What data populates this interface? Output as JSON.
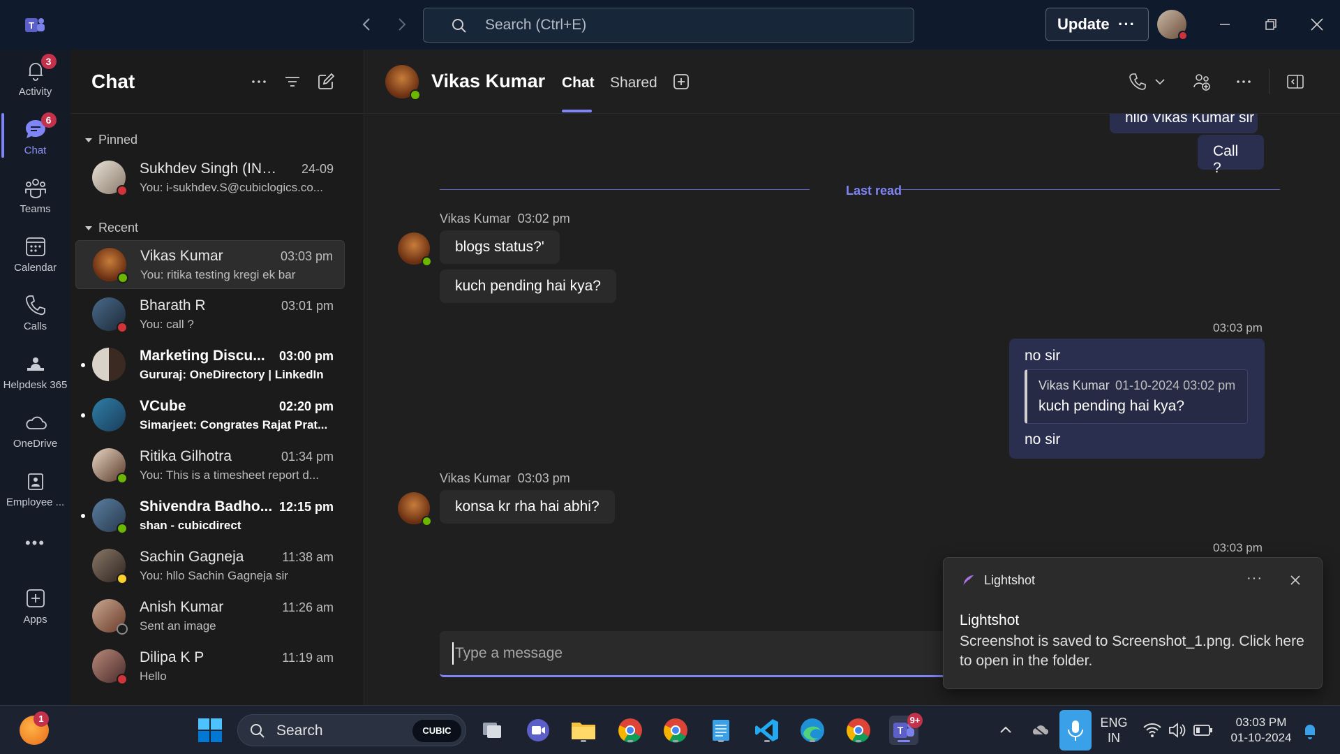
{
  "titlebar": {
    "search_placeholder": "Search (Ctrl+E)",
    "update_label": "Update",
    "update_more": "···"
  },
  "rail": {
    "items": [
      {
        "label": "Activity",
        "badge": "3",
        "icon": "bell-icon"
      },
      {
        "label": "Chat",
        "badge": "6",
        "icon": "chat-icon",
        "active": true
      },
      {
        "label": "Teams",
        "icon": "teams-icon"
      },
      {
        "label": "Calendar",
        "icon": "calendar-icon"
      },
      {
        "label": "Calls",
        "icon": "phone-icon"
      },
      {
        "label": "Helpdesk 365",
        "icon": "helpdesk-icon"
      },
      {
        "label": "OneDrive",
        "icon": "cloud-icon"
      },
      {
        "label": "Employee ...",
        "icon": "employee-icon"
      },
      {
        "label": "Apps",
        "icon": "apps-icon"
      }
    ],
    "more": "•••"
  },
  "chatlist": {
    "title": "Chat",
    "pinned_label": "Pinned",
    "recent_label": "Recent",
    "pinned": [
      {
        "name": "Sukhdev Singh (INT) ...",
        "time": "24-09",
        "preview": "You: i-sukhdev.S@cubiclogics.co...",
        "status": "busy"
      }
    ],
    "recent": [
      {
        "name": "Vikas Kumar",
        "time": "03:03 pm",
        "preview": "You: ritika testing kregi ek bar",
        "status": "available",
        "selected": true
      },
      {
        "name": "Bharath R",
        "time": "03:01 pm",
        "preview": "You: call ?",
        "status": "busy"
      },
      {
        "name": "Marketing Discu...",
        "time": "03:00 pm",
        "preview": "Gururaj: OneDirectory | LinkedIn",
        "unread": true,
        "group": true
      },
      {
        "name": "VCube",
        "time": "02:20 pm",
        "preview": "Simarjeet: Congrates Rajat Prat...",
        "unread": true,
        "group": true
      },
      {
        "name": "Ritika Gilhotra",
        "time": "01:34 pm",
        "preview": "You: This is a timesheet report d...",
        "status": "available"
      },
      {
        "name": "Shivendra Badho...",
        "time": "12:15 pm",
        "preview": "shan - cubicdirect",
        "status": "available",
        "unread": true
      },
      {
        "name": "Sachin Gagneja",
        "time": "11:38 am",
        "preview": "You: hllo Sachin Gagneja sir",
        "status": "away"
      },
      {
        "name": "Anish Kumar",
        "time": "11:26 am",
        "preview": "Sent an image",
        "status": "offline"
      },
      {
        "name": "Dilipa K P",
        "time": "11:19 am",
        "preview": "Hello",
        "status": "busy"
      }
    ]
  },
  "conversation": {
    "name": "Vikas Kumar",
    "tabs": [
      "Chat",
      "Shared"
    ],
    "last_read": "Last read",
    "top_partial": "hllo Vikas Kumar sir",
    "messages": {
      "call": "Call ?",
      "group1_sender": "Vikas Kumar",
      "group1_time": "03:02 pm",
      "group1_msg1": "blogs status?'",
      "group1_msg2": "kuch pending hai kya?",
      "reply_time": "03:03 pm",
      "reply_text1": "no sir",
      "quote_sender": "Vikas Kumar",
      "quote_time": "01-10-2024 03:02 pm",
      "quote_text": "kuch pending hai kya?",
      "reply_text2": "no sir",
      "group2_sender": "Vikas Kumar",
      "group2_time": "03:03 pm",
      "group2_msg1": "konsa kr rha hai abhi?",
      "bottom_time": "03:03 pm"
    },
    "compose_placeholder": "Type a message"
  },
  "toast": {
    "app_name": "Lightshot",
    "more": "···",
    "title": "Lightshot",
    "body": "Screenshot is saved to Screenshot_1.png. Click here to open in the folder."
  },
  "taskbar": {
    "search_label": "Search",
    "search_chip": "CUBIC",
    "notification_badge": "1",
    "teams_badge": "9+",
    "lang_top": "ENG",
    "lang_bottom": "IN",
    "clock_time": "03:03 PM",
    "clock_date": "01-10-2024"
  },
  "colors": {
    "accent": "#7f85f5",
    "available": "#6bb700",
    "busy": "#d13438",
    "away": "#f8d22a",
    "badge": "#c4314b"
  }
}
